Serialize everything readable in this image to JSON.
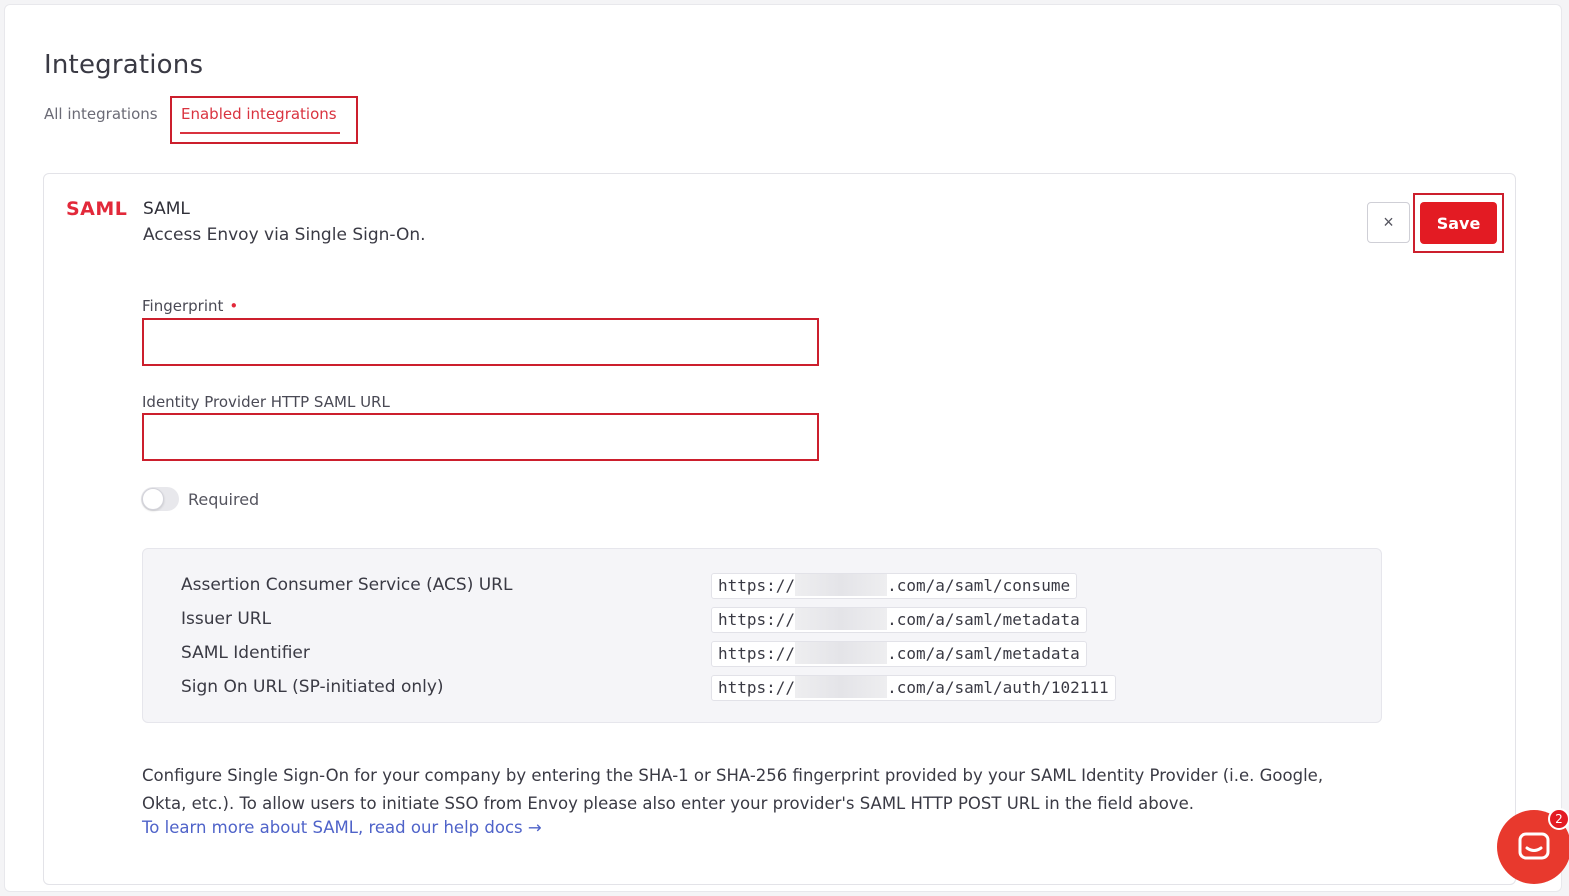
{
  "page": {
    "title": "Integrations"
  },
  "tabs": [
    {
      "label": "All integrations",
      "active": false
    },
    {
      "label": "Enabled integrations",
      "active": true
    }
  ],
  "integration": {
    "logo_text": "SAML",
    "name": "SAML",
    "description": "Access Envoy via Single Sign-On.",
    "close_symbol": "×",
    "save_label": "Save"
  },
  "form": {
    "fingerprint": {
      "label": "Fingerprint",
      "required_marker": "•",
      "value": ""
    },
    "idp_url": {
      "label": "Identity Provider HTTP SAML URL",
      "value": ""
    },
    "required_toggle": {
      "label": "Required",
      "on": false
    }
  },
  "info": [
    {
      "label": "Assertion Consumer Service (ACS) URL",
      "prefix": "https://",
      "suffix": ".com/a/saml/consume"
    },
    {
      "label": "Issuer URL",
      "prefix": "https://",
      "suffix": ".com/a/saml/metadata"
    },
    {
      "label": "SAML Identifier",
      "prefix": "https://",
      "suffix": ".com/a/saml/metadata"
    },
    {
      "label": "Sign On URL (SP-initiated only)",
      "prefix": "https://",
      "suffix": ".com/a/saml/auth/102111"
    }
  ],
  "help": {
    "text": "Configure Single Sign-On for your company by entering the SHA-1 or SHA-256 fingerprint provided by your SAML Identity Provider (i.e. Google, Okta, etc.). To allow users to initiate SSO from Envoy please also enter your provider's SAML HTTP POST URL in the field above.",
    "link": "To learn more about SAML, read our help docs →"
  },
  "chat": {
    "badge_count": "2"
  },
  "colors": {
    "accent_red": "#e31b23",
    "highlight_box": "#cc1f2d",
    "link_blue": "#4f63c9"
  }
}
